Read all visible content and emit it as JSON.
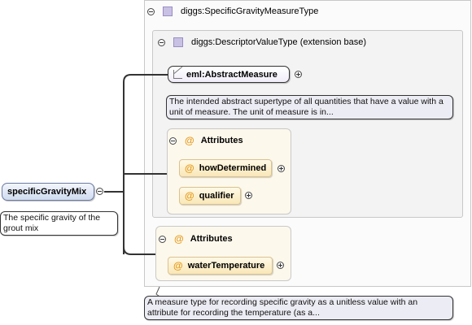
{
  "type": {
    "name": "diggs:SpecificGravityMeasureType",
    "documentation": "A measure type for recording specific gravity as a unitless value with an attribute for recording the temperature (as a..."
  },
  "base": {
    "name": "diggs:DescriptorValueType (extension base)"
  },
  "abstract_element": {
    "name": "eml:AbstractMeasure",
    "documentation": "The intended abstract supertype of all quantities that have a value with a unit of measure. The unit of measure is in..."
  },
  "base_attributes": {
    "label": "Attributes",
    "items": [
      {
        "name": "howDetermined"
      },
      {
        "name": "qualifier"
      }
    ]
  },
  "ext_attributes": {
    "label": "Attributes",
    "items": [
      {
        "name": "waterTemperature"
      }
    ]
  },
  "root": {
    "name": "specificGravityMix",
    "documentation": "The specific gravity of the grout mix"
  },
  "icons": {
    "attribute": "@"
  }
}
